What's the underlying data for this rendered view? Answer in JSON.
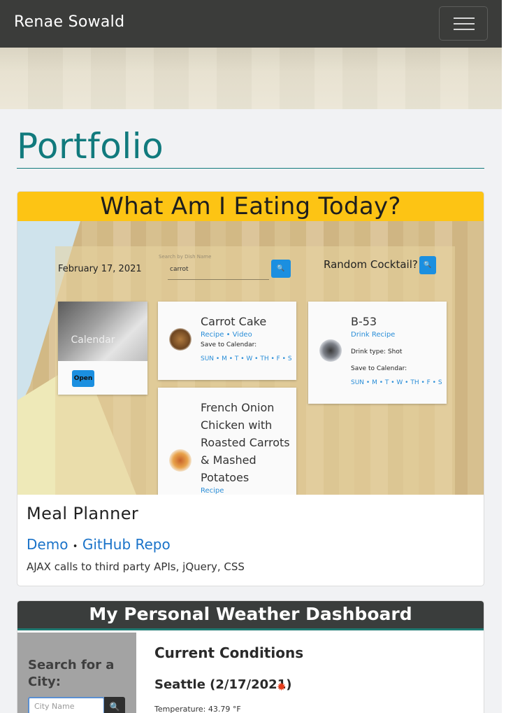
{
  "navbar": {
    "brand": "Renae Sowald",
    "menu_icon": "hamburger-icon"
  },
  "page": {
    "title": "Portfolio"
  },
  "projects": [
    {
      "screenshot": {
        "title": "What Am I Eating Today?",
        "date": "February 17, 2021",
        "search_placeholder": "Search by Dish Name",
        "search_value": "carrot",
        "search_icon": "search-icon",
        "cocktail_label": "Random Cocktail?",
        "calendar_label": "Calendar",
        "open_label": "Open",
        "dish1": {
          "name": "Carrot Cake",
          "links": "Recipe • Video",
          "save": "Save to Calendar:",
          "days": "SUN • M • T • W • TH • F • S"
        },
        "drink": {
          "name": "B-53",
          "link": "Drink Recipe",
          "type": "Drink type: Shot",
          "save": "Save to Calendar:",
          "days": "SUN • M • T • W • TH • F • S"
        },
        "dish2": {
          "name_lines": [
            "French Onion",
            "Chicken with",
            "Roasted Carrots",
            "& Mashed",
            "Potatoes"
          ],
          "link": "Recipe"
        }
      },
      "name": "Meal Planner",
      "demo_label": "Demo",
      "separator": "•",
      "repo_label": "GitHub Repo",
      "tech": "AJAX calls to third party APIs, jQuery, CSS"
    },
    {
      "screenshot": {
        "title": "My Personal Weather Dashboard",
        "search_label_lines": [
          "Search for a",
          "City:"
        ],
        "city_placeholder": "City Name",
        "search_icon": "search-icon",
        "conditions_title": "Current Conditions",
        "city_date": "Seattle (2/17/2021)",
        "weather_icon": "sun-icon",
        "temperature": "Temperature: 43.79 °F"
      }
    }
  ],
  "colors": {
    "accent": "#117a7d",
    "navbar": "#3b3c3a",
    "link": "#1a73c9",
    "eat_header": "#fdc414"
  }
}
